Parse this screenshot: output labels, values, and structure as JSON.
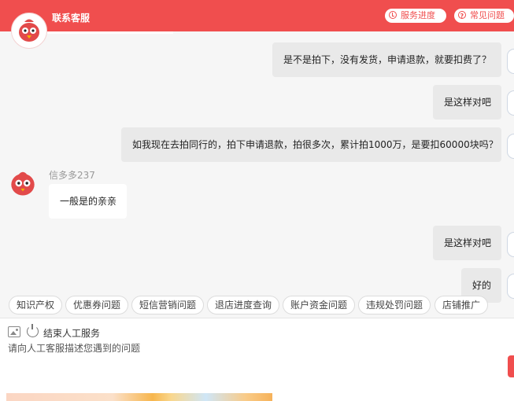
{
  "header": {
    "title": "联系客服",
    "service_progress": "服务进度",
    "faq": "常见问题"
  },
  "messages": [
    {
      "side": "right",
      "text": "是不是拍下，没有发货，申请退款，就要扣费了？"
    },
    {
      "side": "right",
      "text": "是这样对吧"
    },
    {
      "side": "right",
      "text": "如我现在去拍同行的，拍下申请退款，拍很多次，累计拍1000万，是要扣60000块吗？"
    },
    {
      "side": "left",
      "sender": "信多多237",
      "text": "一般是的亲亲"
    },
    {
      "side": "right",
      "text": "是这样对吧"
    },
    {
      "side": "right",
      "text": "好的"
    }
  ],
  "quick_chips": [
    "知识产权",
    "优惠券问题",
    "短信营销问题",
    "退店进度查询",
    "账户资金问题",
    "违规处罚问题",
    "店铺推广"
  ],
  "input": {
    "end_service": "结束人工服务",
    "placeholder": "请向人工客服描述您遇到的问题"
  },
  "colors": {
    "brand": "#f04e4e",
    "bubble_right": "#e9e9e9",
    "bubble_left": "#ffffff",
    "background": "#f6f6f6"
  },
  "icons": [
    "clock-icon",
    "question-icon",
    "image-icon",
    "power-icon",
    "mascot-avatar"
  ]
}
